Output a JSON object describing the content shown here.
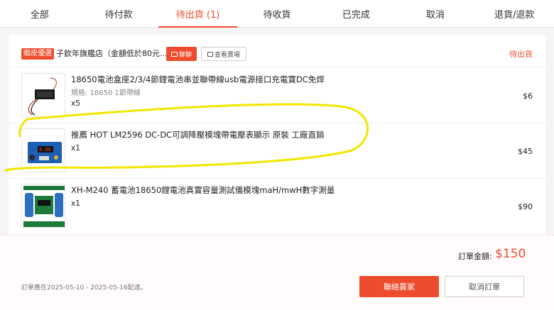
{
  "tabs": [
    {
      "label": "全部"
    },
    {
      "label": "待付款"
    },
    {
      "label": "待出貨 (1)"
    },
    {
      "label": "待收貨"
    },
    {
      "label": "已完成"
    },
    {
      "label": "取消"
    },
    {
      "label": "退貨/退款"
    }
  ],
  "active_tab": "待出貨 (1)",
  "shop": {
    "badge": "蝦皮優選",
    "name": "子欽年旗艦店（金額低於80元...",
    "chat_label": "聊聊",
    "view_shop_label": "查看賣場",
    "status": "待出貨"
  },
  "items": [
    {
      "name": "18650電池盒座2/3/4節鋰電池串並聯帶線usb電源接口充電寶DC免焊",
      "spec": "規格: 18650 1節帶線",
      "qty": "x5",
      "price": "$6"
    },
    {
      "name": "推薦 HOT LM2596 DC-DC可調降壓模塊帶電壓表顯示 原裝 工廠直銷",
      "spec": "",
      "qty": "x1",
      "price": "$45"
    },
    {
      "name": "XH-M240 蓄電池18650鋰電池真實容量測試儀模塊maH/mwH數字測量",
      "spec": "",
      "qty": "x1",
      "price": "$90"
    }
  ],
  "footer": {
    "total_label": "訂單金額:",
    "total_value": "$150",
    "ship_note": "訂單應在2025-05-10 - 2025-05-16配達。",
    "contact_label": "聯絡賣家",
    "cancel_label": "取消訂單"
  },
  "colors": {
    "accent": "#ee4d2d",
    "annotation": "#f2e600"
  }
}
